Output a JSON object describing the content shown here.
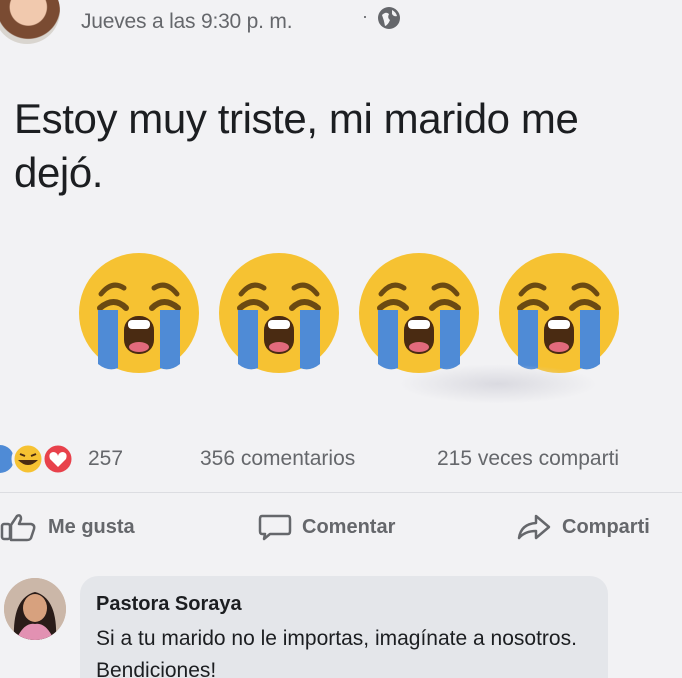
{
  "post": {
    "timestamp": "Jueves a las 9:30 p. m.",
    "separator": "·",
    "privacy_icon": "globe-icon",
    "text": "Estoy muy triste, mi marido me dejó.",
    "emojis": [
      "loudly-crying-face",
      "loudly-crying-face",
      "loudly-crying-face",
      "loudly-crying-face"
    ]
  },
  "stats": {
    "reaction_icons": [
      "love-reaction",
      "haha-reaction",
      "love-reaction"
    ],
    "reaction_count": "257",
    "comments": "356 comentarios",
    "shares": "215 veces comparti"
  },
  "actions": {
    "like_label": "Me gusta",
    "comment_label": "Comentar",
    "share_label": "Comparti"
  },
  "comment": {
    "author": "Pastora Soraya",
    "text": "Si a tu marido no le importas, imagínate a nosotros. Bendiciones!"
  },
  "colors": {
    "background": "#f2f2f4",
    "secondary_text": "#65676b",
    "primary_text": "#1c1e21",
    "comment_bubble": "#e4e6ea",
    "emoji_yellow": "#f6c232",
    "tear_blue": "#4f8bd6",
    "love_red": "#e8414b"
  }
}
